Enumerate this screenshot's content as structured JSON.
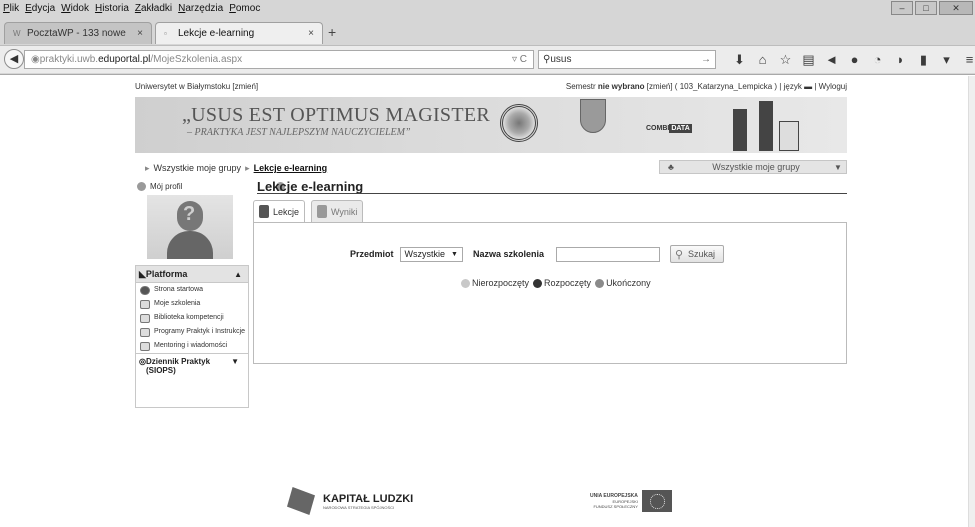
{
  "menu": [
    "Plik",
    "Edycja",
    "Widok",
    "Historia",
    "Zakładki",
    "Narzędzia",
    "Pomoc"
  ],
  "tabs": [
    {
      "label": "PocztaWP - 133 nowe",
      "icon": "wp-favicon"
    },
    {
      "label": "Lekcje e-learning",
      "icon": "page-favicon"
    }
  ],
  "address": {
    "prefix": "praktyki.uwb.",
    "domain": "eduportal.pl",
    "path": "/MojeSzkolenia.aspx"
  },
  "search": {
    "value": "usus"
  },
  "toolbar_icons": [
    "go-arrow-icon",
    "download-icon",
    "home-icon",
    "bookmark-star-icon",
    "reader-icon",
    "send-icon",
    "adblock-icon",
    "chat-icon",
    "extension-icon",
    "menu-button-icon",
    "hamburger-icon"
  ],
  "header": {
    "university": "Uniwersytet w Białymstoku [zmień]",
    "semester_prefix": "Semestr ",
    "semester_value": "nie wybrano",
    "user_info": " [zmień]  ( 103_Katarzyna_Lempicka )  |  język",
    "logout": "| Wyloguj"
  },
  "banner": {
    "line1": "„USUS EST OPTIMUS MAGISTER",
    "line2": "– PRAKTYKA JEST NAJLEPSZYM NAUCZYCIELEM”",
    "logo_text": "COMBI",
    "logo_badge": "DATA"
  },
  "breadcrumb": {
    "item1": "Wszystkie moje grupy",
    "item2": "Lekcje e-learning"
  },
  "group_select": {
    "label": "Wszystkie moje grupy"
  },
  "profile": {
    "label": "Mój profil"
  },
  "sidebar": {
    "section1": "Platforma",
    "items": [
      "Strona startowa",
      "Moje szkolenia",
      "Biblioteka kompetencji",
      "Programy Praktyk i Instrukcje",
      "Mentoring i wiadomości"
    ],
    "section2": "Dziennik Praktyk (SIOPS)"
  },
  "main": {
    "title": "Lekcje e-learning",
    "tabs": [
      "Lekcje",
      "Wyniki"
    ],
    "subject_label": "Przedmiot",
    "subject_value": "Wszystkie",
    "training_label": "Nazwa szkolenia",
    "search_button": "Szukaj",
    "legend": [
      {
        "label": "Nierozpoczęty",
        "color": "#c8c8c8"
      },
      {
        "label": "Rozpoczęty",
        "color": "#333333"
      },
      {
        "label": "Ukończony",
        "color": "#8a8a8a"
      }
    ]
  },
  "footer": {
    "kl_title": "KAPITAŁ LUDZKI",
    "kl_sub": "NARODOWA STRATEGIA SPÓJNOŚCI",
    "ue_title": "UNIA EUROPEJSKA",
    "ue_sub1": "EUROPEJSKI",
    "ue_sub2": "FUNDUSZ SPOŁECZNY"
  }
}
